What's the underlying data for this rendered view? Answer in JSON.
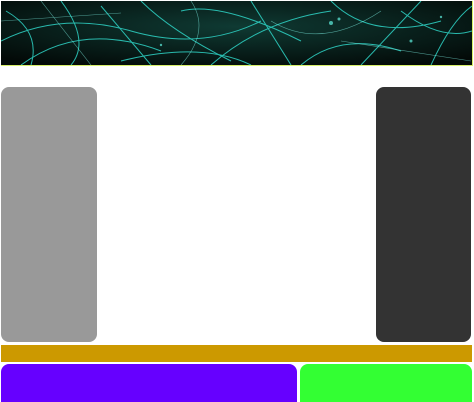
{
  "colors": {
    "banner_background": "#05120f",
    "banner_streaks": "#2fd6c8",
    "banner_border": "#d8f06a",
    "sidebar_left": "#999999",
    "sidebar_right": "#333333",
    "gold_bar": "#cc9900",
    "purple_block": "#6600ff",
    "green_block": "#33ff33",
    "page_background": "#ffffff"
  },
  "header": {
    "image": "abstract-teal-scratches"
  }
}
